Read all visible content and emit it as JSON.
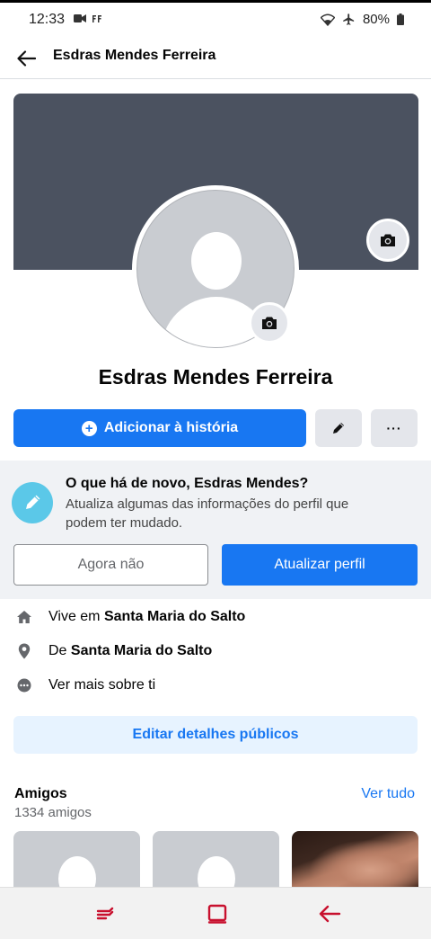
{
  "status_bar": {
    "time": "12:33",
    "battery": "80%",
    "icons": [
      "video-camera-icon",
      "ff-icon",
      "wifi-icon",
      "airplane-icon",
      "battery-icon"
    ]
  },
  "header": {
    "title": "Esdras Mendes Ferreira",
    "back_icon": "arrow-left-icon"
  },
  "profile": {
    "name": "Esdras Mendes Ferreira",
    "cover_color": "#4b5260"
  },
  "actions": {
    "add_story_label": "Adicionar à história",
    "edit_icon": "pencil-icon",
    "more_label": "···"
  },
  "update_prompt": {
    "title": "O que há de novo, Esdras Mendes?",
    "description": "Atualiza algumas das informações do perfil que podem ter mudado.",
    "dismiss_label": "Agora não",
    "confirm_label": "Atualizar perfil"
  },
  "details": {
    "lives_prefix": "Vive em ",
    "lives_place": "Santa Maria do Salto",
    "from_prefix": "De ",
    "from_place": "Santa Maria do Salto",
    "see_more": "Ver mais sobre ti",
    "edit_public_label": "Editar detalhes públicos"
  },
  "friends": {
    "title": "Amigos",
    "see_all": "Ver tudo",
    "count": "1334 amigos"
  },
  "colors": {
    "accent": "#1877f2",
    "accent_light": "#e7f3ff",
    "nav_accent": "#c8102e"
  }
}
